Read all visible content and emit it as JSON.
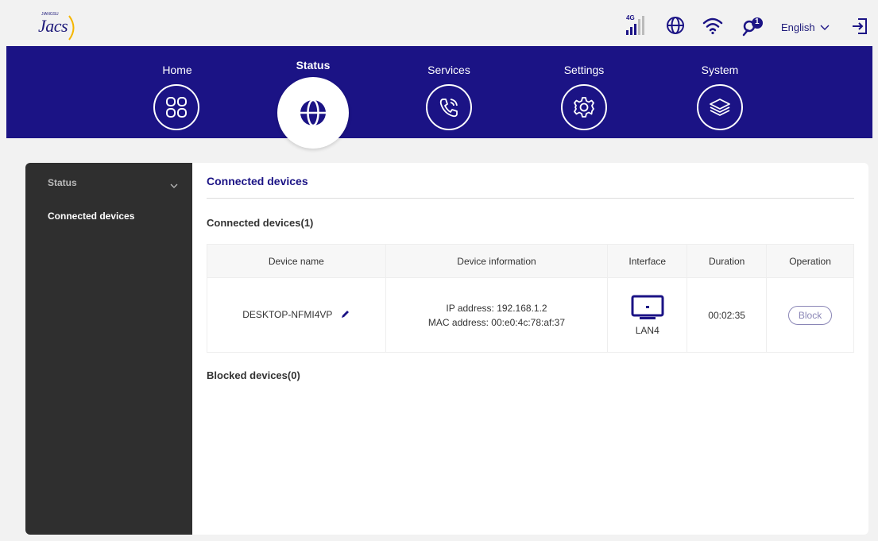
{
  "brand": {
    "logo_text": "Jacs",
    "tiny_text": "JIANGSU"
  },
  "topbar": {
    "network_label": "4G",
    "notification_count": "1",
    "language": "English"
  },
  "nav": {
    "items": [
      {
        "label": "Home",
        "icon": "grid-icon"
      },
      {
        "label": "Status",
        "icon": "globe-icon"
      },
      {
        "label": "Services",
        "icon": "phone-icon"
      },
      {
        "label": "Settings",
        "icon": "gear-icon"
      },
      {
        "label": "System",
        "icon": "layers-icon"
      }
    ],
    "active": "Status",
    "band_color": "#1b1385"
  },
  "sidebar": {
    "header": "Status",
    "items": [
      {
        "label": "Connected devices"
      }
    ]
  },
  "content": {
    "title": "Connected devices",
    "connected_heading": "Connected devices(1)",
    "blocked_heading": "Blocked devices(0)",
    "table": {
      "columns": [
        "Device name",
        "Device information",
        "Interface",
        "Duration",
        "Operation"
      ],
      "rows": [
        {
          "device_name": "DESKTOP-NFMI4VP",
          "ip": "IP address: 192.168.1.2",
          "mac": "MAC address: 00:e0:4c:78:af:37",
          "interface": "LAN4",
          "duration": "00:02:35",
          "operation": "Block"
        }
      ]
    }
  }
}
